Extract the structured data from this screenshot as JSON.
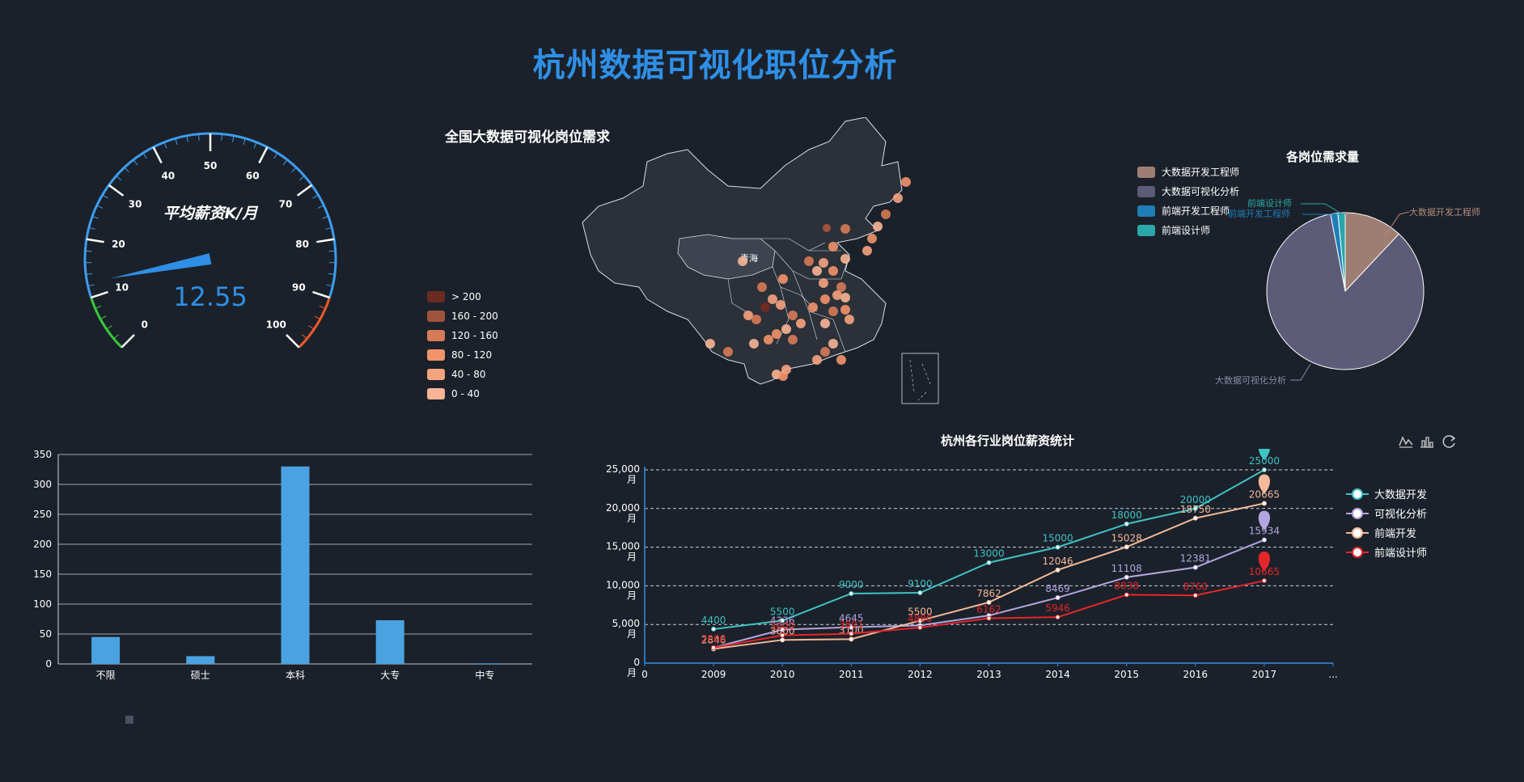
{
  "page": {
    "title": "杭州数据可视化职位分析"
  },
  "colors": {
    "background": "#1b212a",
    "accent": "#2f8fe6",
    "bar": "#4aa3e0"
  },
  "gauge": {
    "label": "平均薪资K/月",
    "value": 12.55,
    "value_text": "12.55",
    "min": 0,
    "max": 100,
    "ticks": [
      "0",
      "10",
      "20",
      "30",
      "40",
      "50",
      "60",
      "70",
      "80",
      "90",
      "100"
    ],
    "ranges": [
      {
        "to": 10,
        "color": "#37c83c"
      },
      {
        "to": 90,
        "color": "#3d9df0"
      },
      {
        "to": 100,
        "color": "#ef5a2a"
      }
    ]
  },
  "map": {
    "title": "全国大数据可视化岗位需求",
    "highlight_label": "青海",
    "legend": [
      {
        "label": "> 200",
        "color": "#6b2b22"
      },
      {
        "label": "160 - 200",
        "color": "#a0533c"
      },
      {
        "label": "120 - 160",
        "color": "#d67b57"
      },
      {
        "label": "80 - 120",
        "color": "#f2936a"
      },
      {
        "label": "40 - 80",
        "color": "#f5a37f"
      },
      {
        "label": "0 - 40",
        "color": "#f7b596"
      }
    ]
  },
  "pie": {
    "title": "各岗位需求量",
    "legend": [
      {
        "label": "大数据开发工程师",
        "color": "#9e7e72"
      },
      {
        "label": "大数据可视化分析",
        "color": "#5c5b78"
      },
      {
        "label": "前端开发工程师",
        "color": "#1f7db8"
      },
      {
        "label": "前端设计师",
        "color": "#2aa7a8"
      }
    ],
    "labels": {
      "dev": "大数据开发工程师",
      "viz": "大数据可视化分析",
      "fe": "前端开发工程师",
      "design": "前端设计师"
    }
  },
  "chart_data": [
    {
      "type": "bar",
      "categories": [
        "不限",
        "硕士",
        "本科",
        "大专",
        "中专"
      ],
      "values": [
        45,
        13,
        330,
        73,
        1
      ],
      "ylim": [
        0,
        350
      ],
      "yticks": [
        "0",
        "50",
        "100",
        "150",
        "200",
        "250",
        "300",
        "350"
      ],
      "grid": true
    },
    {
      "type": "pie",
      "title": "各岗位需求量",
      "slices": [
        {
          "name": "大数据开发工程师",
          "value": 12
        },
        {
          "name": "大数据可视化分析",
          "value": 85
        },
        {
          "name": "前端开发工程师",
          "value": 1.5
        },
        {
          "name": "前端设计师",
          "value": 1.5
        }
      ]
    },
    {
      "type": "line",
      "title": "杭州各行业岗位薪资统计",
      "x": [
        "0",
        "2009",
        "2010",
        "2011",
        "2012",
        "2013",
        "2014",
        "2015",
        "2016",
        "2017",
        "..."
      ],
      "ylim": [
        0,
        25000
      ],
      "yticks": [
        "0\n月",
        "5,000\n月",
        "10,000\n月",
        "15,000\n月",
        "20,000\n月",
        "25,000\n月"
      ],
      "series": [
        {
          "name": "大数据开发",
          "color": "#3fc3c4",
          "values": [
            4400,
            5500,
            9000,
            9100,
            13000,
            15000,
            18000,
            20000,
            25000
          ]
        },
        {
          "name": "可视化分析",
          "color": "#b3a6e0",
          "values": [
            2000,
            4336,
            4645,
            4880,
            6162,
            8469,
            11108,
            12381,
            15934
          ]
        },
        {
          "name": "前端开发",
          "color": "#f2b99a",
          "values": [
            1846,
            3000,
            3100,
            5500,
            7862,
            12046,
            15028,
            18750,
            20665
          ]
        },
        {
          "name": "前端设计师",
          "color": "#e4262b",
          "values": [
            2000,
            3600,
            3800,
            4600,
            5800,
            5946,
            8838,
            8760,
            10665
          ]
        }
      ],
      "labels": {
        "大数据开发": [
          "4400",
          "5500",
          "9000",
          "9100",
          "13000",
          "15000",
          "18000",
          "20000",
          "25000"
        ],
        "可视化分析": [
          "",
          "4336",
          "4645",
          "",
          "",
          "8469",
          "11108",
          "12381",
          "15934"
        ],
        "前端开发": [
          "2846",
          "3000",
          "3100",
          "5500",
          "7862",
          "12046",
          "15028",
          "18750",
          "20665"
        ],
        "前端设计师": [
          "2000",
          "3600",
          "3801",
          "4880",
          "6162",
          "5946",
          "8838",
          "8760",
          "10665"
        ]
      },
      "grid": true
    }
  ],
  "toolbox": [
    "line-chart-icon",
    "bar-chart-icon",
    "refresh-icon"
  ]
}
